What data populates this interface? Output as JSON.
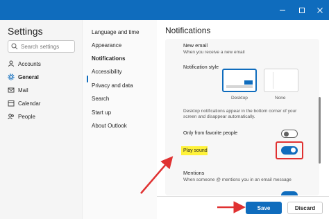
{
  "window": {
    "minimize_icon": "minimize-icon",
    "maximize_icon": "maximize-icon",
    "close_icon": "close-icon",
    "accent_color": "#0f6cbd"
  },
  "sidebar": {
    "title": "Settings",
    "search_placeholder": "Search settings",
    "items": [
      {
        "label": "Accounts",
        "icon": "person-icon"
      },
      {
        "label": "General",
        "icon": "gear-icon"
      },
      {
        "label": "Mail",
        "icon": "mail-icon"
      },
      {
        "label": "Calendar",
        "icon": "calendar-icon"
      },
      {
        "label": "People",
        "icon": "people-icon"
      }
    ],
    "active": "General"
  },
  "subnav": {
    "items": [
      "Language and time",
      "Appearance",
      "Notifications",
      "Accessibility",
      "Privacy and data",
      "Search",
      "Start up",
      "About Outlook"
    ],
    "active": "Notifications"
  },
  "main": {
    "title": "Notifications",
    "new_email": {
      "heading": "New email",
      "description": "When you receive a new email",
      "style_label": "Notification style",
      "options": [
        {
          "label": "Desktop",
          "selected": true
        },
        {
          "label": "None",
          "selected": false
        }
      ],
      "desktop_desc": "Desktop notifications appear in the bottom corner of your screen and disappear automatically.",
      "favorites_label": "Only from favorite people",
      "favorites_on": false,
      "play_sound_label": "Play sound",
      "play_sound_on": true
    },
    "mentions": {
      "heading": "Mentions",
      "description": "When someone @ mentions you in an email message"
    }
  },
  "footer": {
    "save_label": "Save",
    "discard_label": "Discard"
  },
  "annotations": {
    "highlight_color": "#fff23a",
    "arrow_color": "#e03131"
  }
}
